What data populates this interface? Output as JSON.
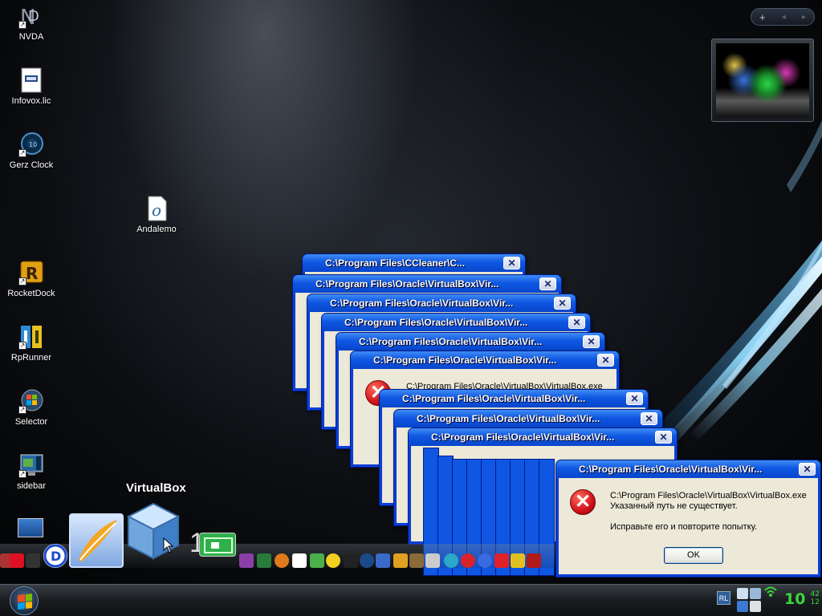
{
  "desktop_icons": [
    {
      "label": "NVDA",
      "icon": "nvda-icon"
    },
    {
      "label": "Infovox.lic",
      "icon": "license-file-icon"
    },
    {
      "label": "Gerz Clock",
      "icon": "clock-icon"
    },
    {
      "label": "Andalemo",
      "icon": "opera-file-icon"
    },
    {
      "label": "RocketDock",
      "icon": "rocketdock-icon"
    },
    {
      "label": "RpRunner",
      "icon": "rprunner-icon"
    },
    {
      "label": "Selector",
      "icon": "windows-orb-icon"
    },
    {
      "label": "sidebar",
      "icon": "sidebar-icon"
    }
  ],
  "background_windows": [
    {
      "title": "C:\\Program Files\\CCleaner\\C..."
    },
    {
      "title": "C:\\Program Files\\Oracle\\VirtualBox\\Vir..."
    },
    {
      "title": "C:\\Program Files\\Oracle\\VirtualBox\\Vir..."
    },
    {
      "title": "C:\\Program Files\\Oracle\\VirtualBox\\Vir..."
    },
    {
      "title": "C:\\Program Files\\Oracle\\VirtualBox\\Vir..."
    },
    {
      "title": "C:\\Program Files\\Oracle\\VirtualBox\\Vir..."
    },
    {
      "title": "C:\\Program Files\\Oracle\\VirtualBox\\Vir..."
    },
    {
      "title": "C:\\Program Files\\Oracle\\VirtualBox\\Vir..."
    },
    {
      "title": "C:\\Program Files\\Oracle\\VirtualBox\\Vir..."
    }
  ],
  "background_message_fragment": "C:\\Program Files\\Oracle\\VirtualBox\\VirtualBox.exe",
  "error_dialog": {
    "title": "C:\\Program Files\\Oracle\\VirtualBox\\Vir...",
    "close_label": "✕",
    "line1": "C:\\Program Files\\Oracle\\VirtualBox\\VirtualBox.exe",
    "line2": "Указанный путь не существует.",
    "line3": "Исправьте его и повторите попытку.",
    "ok_label": "OK"
  },
  "dock": {
    "hover_label": "VirtualBox",
    "separator_text": "1"
  },
  "gadget_bar": {
    "add": "+",
    "prev": "◂",
    "next": "▸"
  },
  "taskbar": {
    "language": "RL",
    "clock_hm": "10",
    "clock_min": "42",
    "clock_sec": "12"
  },
  "colors": {
    "xp_title_blue": "#0f57e2",
    "error_red": "#d0131a",
    "clock_green": "#3ad63a"
  }
}
